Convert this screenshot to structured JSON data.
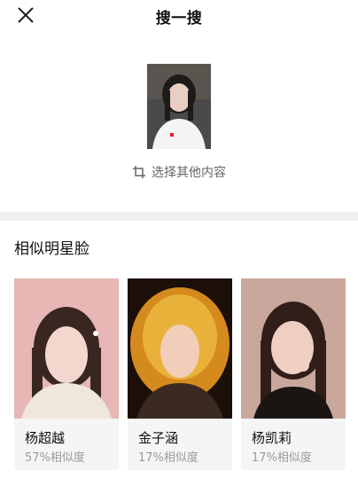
{
  "header": {
    "title": "搜一搜"
  },
  "query": {
    "select_other_label": "选择其他内容"
  },
  "section": {
    "title": "相似明星脸"
  },
  "results": [
    {
      "name": "杨超越",
      "similarity": "57%相似度"
    },
    {
      "name": "金子涵",
      "similarity": "17%相似度"
    },
    {
      "name": "杨凯莉",
      "similarity": "17%相似度"
    }
  ]
}
